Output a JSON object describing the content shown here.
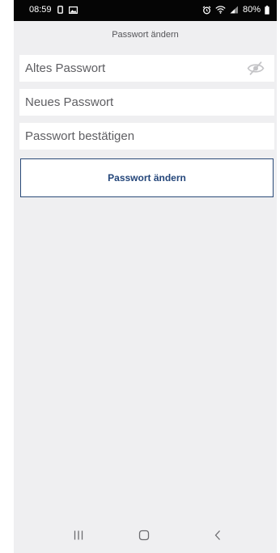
{
  "status_bar": {
    "time": "08:59",
    "battery": "80%",
    "left_icons": [
      "sim-icon",
      "image-icon"
    ],
    "right_icons": [
      "alarm-icon",
      "wifi-icon",
      "signal-icon",
      "battery-icon"
    ]
  },
  "header": {
    "title": "Passwort ändern"
  },
  "form": {
    "old_password": {
      "placeholder": "Altes Passwort",
      "value": ""
    },
    "new_password": {
      "placeholder": "Neues Passwort",
      "value": ""
    },
    "confirm_password": {
      "placeholder": "Passwort bestätigen",
      "value": ""
    },
    "visibility_toggle_icon": "eye-slash-icon",
    "submit_label": "Passwort ändern"
  },
  "nav_bar": {
    "items": [
      "recent-apps-icon",
      "home-icon",
      "back-icon"
    ]
  },
  "colors": {
    "background": "#efeff1",
    "status_bar": "#050505",
    "field_background": "#ffffff",
    "button_border": "#2a4a78",
    "button_text": "#24467a"
  }
}
